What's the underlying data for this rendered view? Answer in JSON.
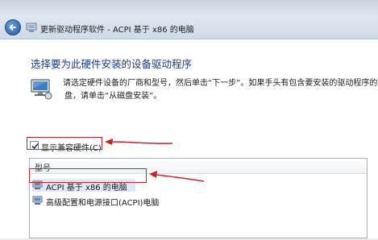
{
  "window": {
    "title": "更新驱动程序软件 - ACPI 基于 x86 的电脑",
    "back_icon": "back-arrow-icon",
    "title_icon": "device-icon"
  },
  "dialog": {
    "heading": "选择要为此硬件安装的设备驱动程序",
    "instruction_line1": "请选定硬件设备的厂商和型号，然后单击“下一步”。如果手头有包含要安装的驱动程序的磁",
    "instruction_line2": "盘，请单击“从磁盘安装”。",
    "show_compatible_label": "显示兼容硬件(C)",
    "show_compatible_checked": true,
    "list": {
      "header": "型号",
      "items": [
        {
          "label": "ACPI 基于 x86 的电脑",
          "selected": true
        },
        {
          "label": "高级配置和电源接口(ACPI)电脑",
          "selected": false
        }
      ]
    }
  },
  "annotation_color": "#c8232b"
}
